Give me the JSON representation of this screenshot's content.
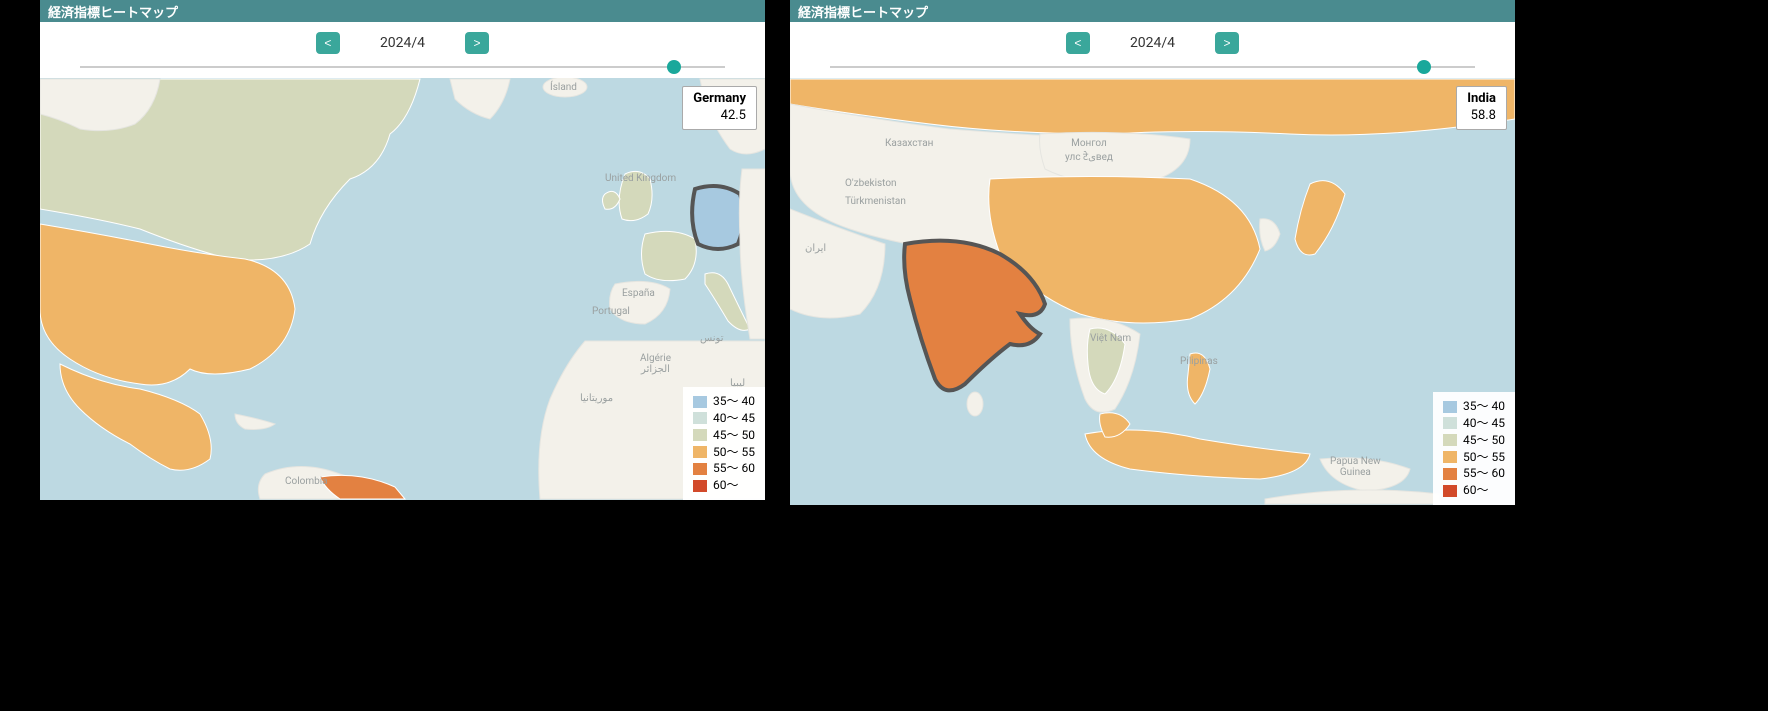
{
  "title": "経済指標ヒートマップ",
  "date": "2024/4",
  "nav": {
    "prev": "<",
    "next": ">"
  },
  "legend": [
    {
      "label": "35～ 40",
      "color": "#a7c9e0"
    },
    {
      "label": "40～ 45",
      "color": "#cfe0da"
    },
    {
      "label": "45～ 50",
      "color": "#d4d9bb"
    },
    {
      "label": "50～ 55",
      "color": "#efb567"
    },
    {
      "label": "55～ 60",
      "color": "#e38141"
    },
    {
      "label": "60～",
      "color": "#d24a2a"
    }
  ],
  "panels": {
    "left": {
      "tooltip": {
        "country": "Germany",
        "value": "42.5"
      },
      "labels": {
        "island": "Ísland",
        "uk": "United Kingdom",
        "espana": "España",
        "portugal": "Portugal",
        "algerie": "Algérie\nالجزائر",
        "libya": "ليبيا",
        "tunis": "تونس",
        "mauritania": "موريتانيا",
        "colombia": "Colombia"
      }
    },
    "right": {
      "tooltip": {
        "country": "India",
        "value": "58.8"
      },
      "labels": {
        "kazakhstan": "Казахстан",
        "uzbekistan": "O'zbekiston",
        "turkmenistan": "Türkmenistan",
        "iran": "ایران",
        "mongolia": "Монгол\nулс टेیвед",
        "vietnam": "Việt Nam",
        "pilipinas": "Pilipinas",
        "png": "Papua New\nGuinea"
      }
    }
  }
}
